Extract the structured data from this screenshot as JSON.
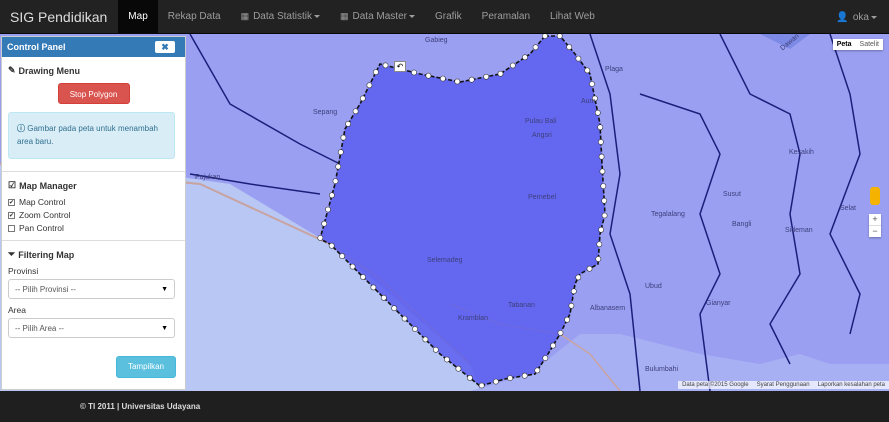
{
  "navbar": {
    "brand": "SIG Pendidikan",
    "items": [
      {
        "label": "Map",
        "active": true
      },
      {
        "label": "Rekap Data"
      },
      {
        "label": "Data Statistik",
        "icon": "calendar-icon",
        "dropdown": true
      },
      {
        "label": "Data Master",
        "icon": "calendar-icon",
        "dropdown": true
      },
      {
        "label": "Grafik"
      },
      {
        "label": "Peramalan"
      },
      {
        "label": "Lihat Web"
      }
    ],
    "user": "oka"
  },
  "map": {
    "type_controls": [
      "Peta",
      "Satelit"
    ],
    "zoom_in": "+",
    "zoom_out": "−",
    "attribution": [
      "Data peta ©2015 Google",
      "Syarat Penggunaan",
      "Laporkan kesalahan peta"
    ],
    "places": [
      "Gabieg",
      "Plaga",
      "Sepang",
      "Pulau Bali",
      "Angsri",
      "Pujukan",
      "Pernebel",
      "Tegalalang",
      "Selemadeg",
      "Tabanan",
      "Kramblan",
      "Ubud",
      "Gianyar",
      "Bangli",
      "Susut",
      "Kesakih",
      "Selat",
      "Sideman",
      "Albanasem",
      "Bulumbahi",
      "Dawan",
      "Aum"
    ],
    "polygon_color": "#5b5ef0",
    "background_color": "#9a9ff2",
    "sea_color": "#b8c7f3"
  },
  "panel": {
    "title": "Control Panel",
    "close": "✖",
    "drawing_menu": "Drawing Menu",
    "stop_polygon": "Stop Polygon",
    "alert": "Gambar pada peta untuk menambah area baru.",
    "map_manager": "Map Manager",
    "checks": [
      {
        "label": "Map Control",
        "checked": true
      },
      {
        "label": "Zoom Control",
        "checked": true
      },
      {
        "label": "Pan Control",
        "checked": false
      }
    ],
    "filtering": "Filtering Map",
    "provinsi_label": "Provinsi",
    "provinsi_value": "-- Pilih Provinsi --",
    "area_label": "Area",
    "area_value": "-- Pilih Area --",
    "submit": "Tampilkan"
  },
  "footer": "© TI 2011 | Universitas Udayana"
}
